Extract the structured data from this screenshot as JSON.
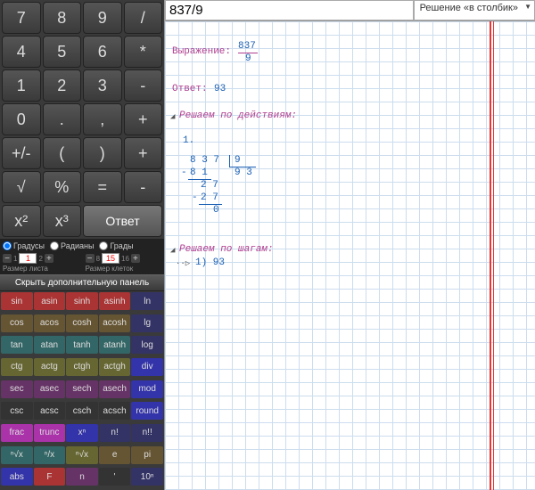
{
  "input": {
    "value": "837/9"
  },
  "mode": {
    "label": "Решение «в столбик»"
  },
  "keys": {
    "main": [
      "7",
      "8",
      "9",
      "/",
      "4",
      "5",
      "6",
      "*",
      "1",
      "2",
      "3",
      "-",
      "0",
      ".",
      ",",
      "+",
      "+/-",
      "(",
      ")",
      "+",
      "√",
      "%",
      "=",
      "-",
      "x²",
      "x³"
    ],
    "answer": "Ответ"
  },
  "settings": {
    "angle": {
      "deg": "Градусы",
      "rad": "Радианы",
      "grad": "Грады",
      "selected": "deg"
    },
    "sheet": {
      "label": "Размер листа",
      "value": "1",
      "min": "1",
      "max": "2"
    },
    "cells": {
      "label": "Размер клеток",
      "value": "15",
      "min": "8",
      "max": "16"
    },
    "hide": "Скрыть дополнительную панель"
  },
  "ext": [
    [
      "sin",
      "asin",
      "sinh",
      "asinh",
      "ln"
    ],
    [
      "cos",
      "acos",
      "cosh",
      "acosh",
      "lg"
    ],
    [
      "tan",
      "atan",
      "tanh",
      "atanh",
      "log"
    ],
    [
      "ctg",
      "actg",
      "ctgh",
      "actgh",
      "div"
    ],
    [
      "sec",
      "asec",
      "sech",
      "asech",
      "mod"
    ],
    [
      "csc",
      "acsc",
      "csch",
      "acsch",
      "round"
    ],
    [
      "frac",
      "trunc",
      "xⁿ",
      "n!",
      "n!!"
    ],
    [
      "ⁿ√x",
      "ⁿ/x",
      "ⁿ√x",
      "e",
      "pi"
    ],
    [
      "abs",
      "F",
      "n",
      "'",
      "10ⁿ"
    ]
  ],
  "ext_colors": [
    [
      "red",
      "red",
      "red",
      "red",
      "blue"
    ],
    [
      "brown",
      "brown",
      "brown",
      "brown",
      "blue"
    ],
    [
      "teal",
      "teal",
      "teal",
      "teal",
      "blue"
    ],
    [
      "olive",
      "olive",
      "olive",
      "olive",
      "navy"
    ],
    [
      "purple",
      "purple",
      "purple",
      "purple",
      "navy"
    ],
    [
      "dark",
      "dark",
      "dark",
      "dark",
      "navy"
    ],
    [
      "mag",
      "mag",
      "navy",
      "blue",
      "blue"
    ],
    [
      "teal",
      "teal",
      "olive",
      "brown",
      "brown"
    ],
    [
      "navy",
      "red",
      "purple",
      "dark",
      "blue"
    ]
  ],
  "solution": {
    "expr_label": "Выражение:",
    "expr_num": "837",
    "expr_den": "9",
    "ans_label": "Ответ:",
    "ans_val": "93",
    "steps_label": "Решаем по действиям:",
    "step1": "1.",
    "ld": {
      "r1": "8 3 7",
      "r1b": "9",
      "r2": "8 1",
      "r2b": "9 3",
      "r3": "2 7",
      "r4": "2 7",
      "r5": "0"
    },
    "steps2_label": "Решаем по шагам:",
    "step2": "1) 93"
  }
}
